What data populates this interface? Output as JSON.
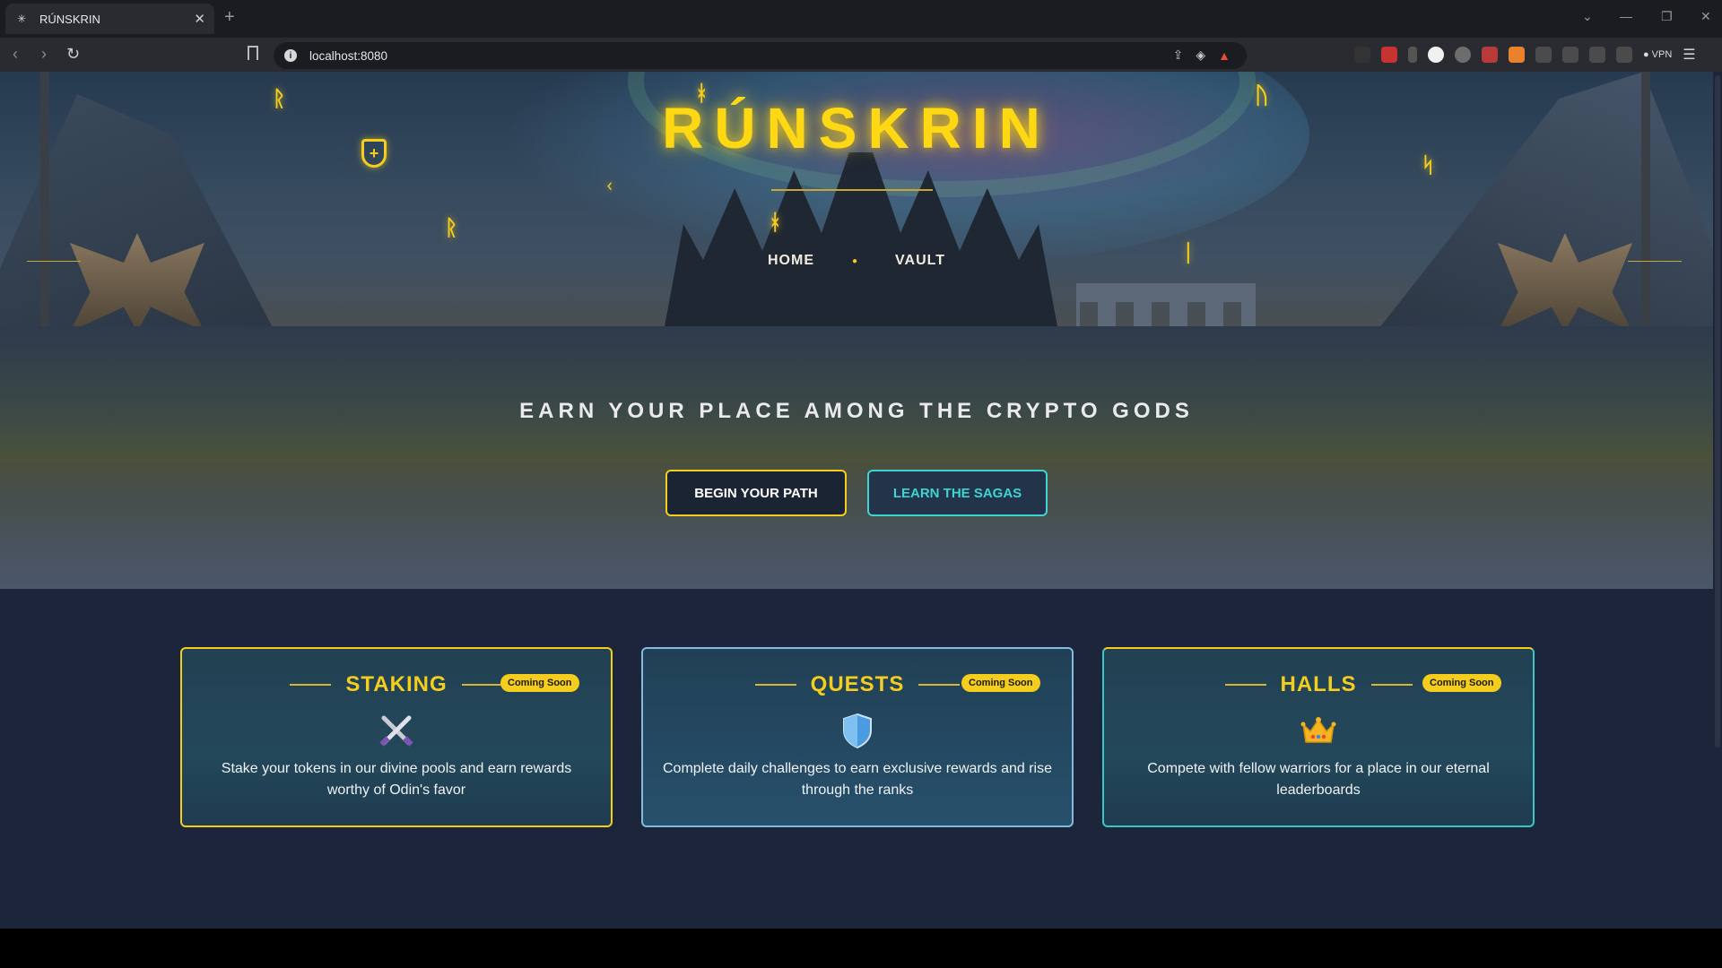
{
  "browser": {
    "tab_title": "RÚNSKRIN",
    "url": "localhost:8080",
    "vpn_label": "VPN"
  },
  "site": {
    "title": "RÚNSKRIN",
    "nav": [
      {
        "label": "HOME"
      },
      {
        "label": "VAULT"
      }
    ]
  },
  "cta": {
    "heading": "EARN YOUR PLACE AMONG THE CRYPTO GODS",
    "primary_button": "BEGIN YOUR PATH",
    "secondary_button": "LEARN THE SAGAS"
  },
  "features": [
    {
      "title": "STAKING",
      "badge": "Coming Soon",
      "icon": "crossed-swords-icon",
      "description": "Stake your tokens in our divine pools and earn rewards worthy of Odin's favor"
    },
    {
      "title": "QUESTS",
      "badge": "Coming Soon",
      "icon": "shield-icon",
      "description": "Complete daily challenges to earn exclusive rewards and rise through the ranks"
    },
    {
      "title": "HALLS",
      "badge": "Coming Soon",
      "icon": "crown-icon",
      "description": "Compete with fellow warriors for a place in our eternal leaderboards"
    }
  ],
  "colors": {
    "gold": "#f5cd1c",
    "teal": "#3ed4d1",
    "page_bg": "#1c2539"
  }
}
